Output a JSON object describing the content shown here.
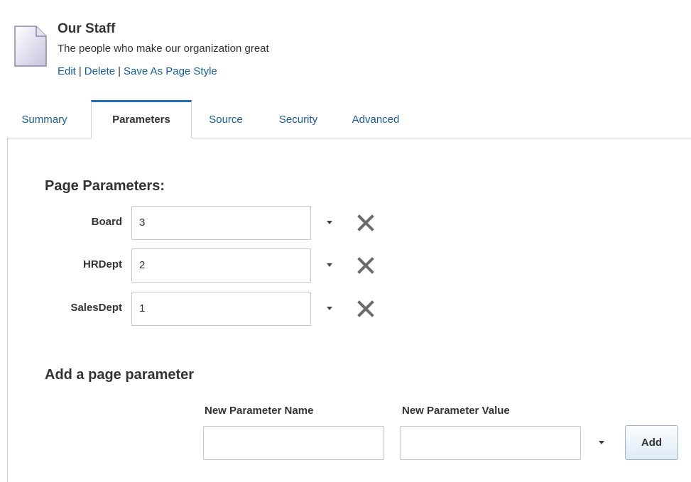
{
  "header": {
    "title": "Our Staff",
    "description": "The people who make our organization great",
    "actions": {
      "edit": "Edit",
      "delete": "Delete",
      "save_as_page_style": "Save As Page Style",
      "separator": "|"
    }
  },
  "tabs": [
    {
      "label": "Summary",
      "active": false
    },
    {
      "label": "Parameters",
      "active": true
    },
    {
      "label": "Source",
      "active": false
    },
    {
      "label": "Security",
      "active": false
    },
    {
      "label": "Advanced",
      "active": false
    }
  ],
  "page_parameters": {
    "heading": "Page Parameters:",
    "rows": [
      {
        "name": "Board",
        "value": "3"
      },
      {
        "name": "HRDept",
        "value": "2"
      },
      {
        "name": "SalesDept",
        "value": "1"
      }
    ]
  },
  "add_parameter": {
    "heading": "Add a page parameter",
    "name_header": "New Parameter Name",
    "value_header": "New Parameter Value",
    "name_value": "",
    "value_value": "",
    "add_label": "Add"
  },
  "icons": {
    "page": "document-icon",
    "dropdown": "chevron-down-icon",
    "remove": "close-icon"
  },
  "colors": {
    "link": "#145c9e",
    "active_tab_border": "#1e6fb7",
    "remove_icon": "#6b6b6b"
  }
}
